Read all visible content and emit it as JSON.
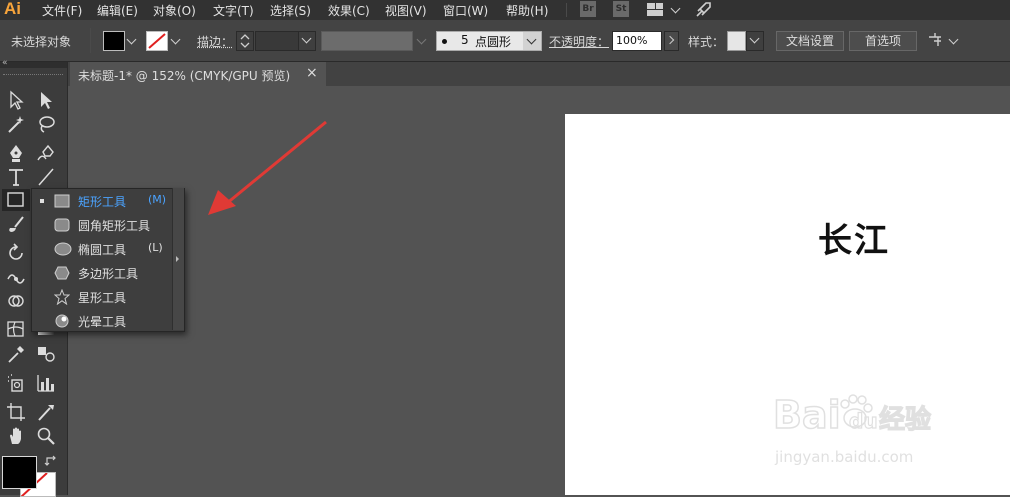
{
  "app": {
    "logo": "Ai",
    "brand_color": "#f7a43b"
  },
  "menubar": {
    "items": [
      "文件(F)",
      "编辑(E)",
      "对象(O)",
      "文字(T)",
      "选择(S)",
      "效果(C)",
      "视图(V)",
      "窗口(W)",
      "帮助(H)"
    ],
    "bridge_badge": "Br",
    "stock_badge": "St"
  },
  "controlbar": {
    "selection_status": "未选择对象",
    "stroke_label": "描边",
    "stroke_value": "",
    "brush_size": "5",
    "brush_name": "点圆形",
    "opacity_label": "不透明度",
    "opacity_value": "100%",
    "style_label": "样式",
    "doc_setup_button": "文档设置",
    "preferences_button": "首选项"
  },
  "document_tab": {
    "title": "未标题-1* @ 152% (CMYK/GPU 预览)",
    "close_glyph": "×"
  },
  "flyout": {
    "items": [
      {
        "label": "矩形工具",
        "shortcut": "(M)",
        "icon": "rectangle-icon",
        "active": true
      },
      {
        "label": "圆角矩形工具",
        "shortcut": "",
        "icon": "rounded-rectangle-icon",
        "active": false
      },
      {
        "label": "椭圆工具",
        "shortcut": "(L)",
        "icon": "ellipse-icon",
        "active": false
      },
      {
        "label": "多边形工具",
        "shortcut": "",
        "icon": "polygon-icon",
        "active": false
      },
      {
        "label": "星形工具",
        "shortcut": "",
        "icon": "star-icon",
        "active": false
      },
      {
        "label": "光晕工具",
        "shortcut": "",
        "icon": "flare-icon",
        "active": false
      }
    ],
    "active_color": "#4ba3ff"
  },
  "artboard": {
    "text": "长江"
  },
  "watermark": {
    "brand": "Bai",
    "brand2": "du",
    "cn": "经验",
    "url": "jingyan.baidu.com"
  },
  "colors": {
    "fill": "#000000",
    "stroke": "none",
    "annotation_arrow": "#e03a35"
  }
}
